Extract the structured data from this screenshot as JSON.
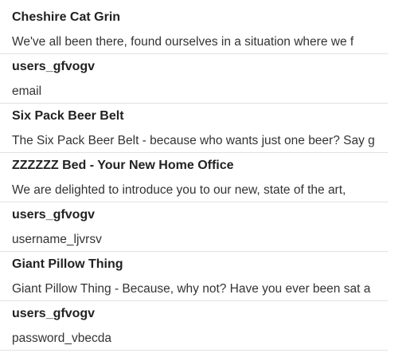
{
  "items": [
    {
      "title": "Cheshire Cat Grin",
      "description": "We've all been there, found ourselves in a situation where we f"
    },
    {
      "title": "users_gfvogv",
      "description": "email"
    },
    {
      "title": "Six Pack Beer Belt",
      "description": "The Six Pack Beer Belt - because who wants just one beer? Say g"
    },
    {
      "title": "ZZZZZZ Bed - Your New Home Office",
      "description": "We are delighted to introduce you to our new, state of the art,"
    },
    {
      "title": "users_gfvogv",
      "description": "username_ljvrsv"
    },
    {
      "title": "Giant Pillow Thing",
      "description": "Giant Pillow Thing - Because, why not? Have you ever been sat a"
    },
    {
      "title": "users_gfvogv",
      "description": "password_vbecda"
    }
  ]
}
